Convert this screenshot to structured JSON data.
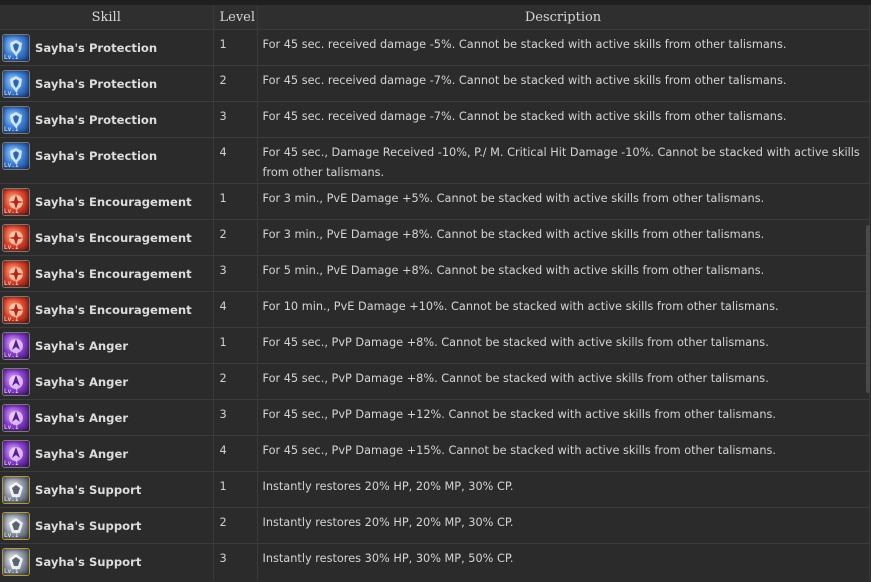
{
  "headers": {
    "skill": "Skill",
    "level": "Level",
    "description": "Description"
  },
  "icon_styles": {
    "blue": {
      "icon": "sayhas-protection-icon",
      "color": "#3f7fd8"
    },
    "red": {
      "icon": "sayhas-encouragement-icon",
      "color": "#e0452a"
    },
    "purple": {
      "icon": "sayhas-anger-icon",
      "color": "#8a3fd0"
    },
    "silver": {
      "icon": "sayhas-support-icon",
      "color": "#8c96a6"
    }
  },
  "icon_badge": "Lv.1",
  "rows": [
    {
      "skill": "Sayha's Protection",
      "style": "blue",
      "level": "1",
      "description": "For 45 sec. received damage -5%. Cannot be stacked with active skills from other talismans."
    },
    {
      "skill": "Sayha's Protection",
      "style": "blue",
      "level": "2",
      "description": "For 45 sec. received damage -7%. Cannot be stacked with active skills from other talismans."
    },
    {
      "skill": "Sayha's Protection",
      "style": "blue",
      "level": "3",
      "description": "For 45 sec. received damage -7%. Cannot be stacked with active skills from other talismans."
    },
    {
      "skill": "Sayha's Protection",
      "style": "blue",
      "level": "4",
      "description": "For 45 sec., Damage Received -10%, P./ M. Critical Hit Damage -10%. Cannot be stacked with active skills from other talismans.",
      "tall": true
    },
    {
      "skill": "Sayha's Encouragement",
      "style": "red",
      "level": "1",
      "description": "For 3 min., PvE Damage +5%. Cannot be stacked with active skills from other talismans."
    },
    {
      "skill": "Sayha's Encouragement",
      "style": "red",
      "level": "2",
      "description": "For 3 min., PvE Damage +8%. Cannot be stacked with active skills from other talismans."
    },
    {
      "skill": "Sayha's Encouragement",
      "style": "red",
      "level": "3",
      "description": "For 5 min., PvE Damage +8%. Cannot be stacked with active skills from other talismans."
    },
    {
      "skill": "Sayha's Encouragement",
      "style": "red",
      "level": "4",
      "description": "For 10 min., PvE Damage +10%. Cannot be stacked with active skills from other talismans."
    },
    {
      "skill": "Sayha's Anger",
      "style": "purple",
      "level": "1",
      "description": "For 45 sec., PvP Damage +8%. Cannot be stacked with active skills from other talismans."
    },
    {
      "skill": "Sayha's Anger",
      "style": "purple",
      "level": "2",
      "description": "For 45 sec., PvP Damage +8%. Cannot be stacked with active skills from other talismans."
    },
    {
      "skill": "Sayha's Anger",
      "style": "purple",
      "level": "3",
      "description": "For 45 sec., PvP Damage +12%. Cannot be stacked with active skills from other talismans."
    },
    {
      "skill": "Sayha's Anger",
      "style": "purple",
      "level": "4",
      "description": "For 45 sec., PvP Damage +15%. Cannot be stacked with active skills from other talismans."
    },
    {
      "skill": "Sayha's Support",
      "style": "silver",
      "level": "1",
      "description": "Instantly restores 20% HP, 20% MP, 30% CP."
    },
    {
      "skill": "Sayha's Support",
      "style": "silver",
      "level": "2",
      "description": "Instantly restores 20% HP, 20% MP, 30% CP."
    },
    {
      "skill": "Sayha's Support",
      "style": "silver",
      "level": "3",
      "description": "Instantly restores 30% HP, 30% MP, 50% CP."
    }
  ]
}
